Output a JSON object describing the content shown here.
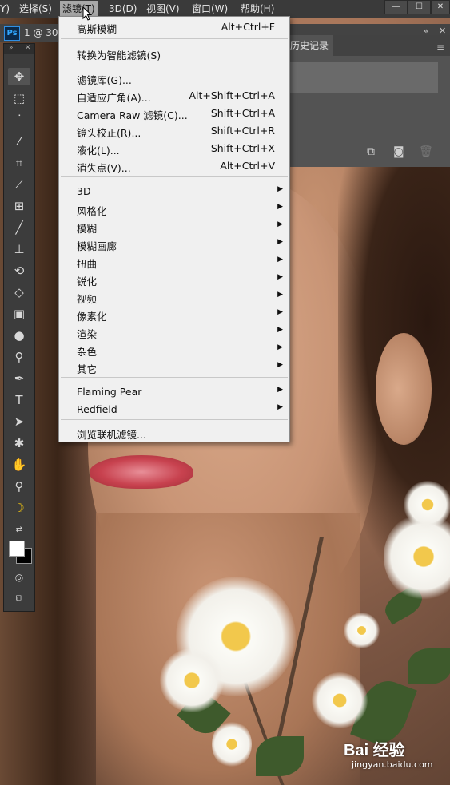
{
  "menubar": {
    "items": [
      {
        "label": "Y)",
        "active": false
      },
      {
        "label": "选择(S)",
        "active": false
      },
      {
        "label": "滤镜(T)",
        "active": true
      },
      {
        "label": "3D(D)",
        "active": false
      },
      {
        "label": "视图(V)",
        "active": false
      },
      {
        "label": "窗口(W)",
        "active": false
      },
      {
        "label": "帮助(H)",
        "active": false
      }
    ],
    "window_controls": [
      "—",
      "☐",
      "✕"
    ]
  },
  "document": {
    "app_badge": "Ps",
    "tab_title": "1 @ 30."
  },
  "panel": {
    "tab_label": "历史记录",
    "menu_icon": "≡",
    "footer_icons": [
      "new-snapshot-icon",
      "camera-icon",
      "trash-icon"
    ]
  },
  "filter_menu": {
    "items": [
      {
        "label": "高斯模糊",
        "shortcut": "Alt+Ctrl+F"
      },
      {
        "label": "转换为智能滤镜(S)",
        "shortcut": ""
      },
      {
        "label": "滤镜库(G)...",
        "shortcut": ""
      },
      {
        "label": "自适应广角(A)...",
        "shortcut": "Alt+Shift+Ctrl+A"
      },
      {
        "label": "Camera Raw 滤镜(C)...",
        "shortcut": "Shift+Ctrl+A"
      },
      {
        "label": "镜头校正(R)...",
        "shortcut": "Shift+Ctrl+R"
      },
      {
        "label": "液化(L)...",
        "shortcut": "Shift+Ctrl+X"
      },
      {
        "label": "消失点(V)...",
        "shortcut": "Alt+Ctrl+V"
      },
      {
        "label": "3D",
        "submenu": true
      },
      {
        "label": "风格化",
        "submenu": true
      },
      {
        "label": "模糊",
        "submenu": true
      },
      {
        "label": "模糊画廊",
        "submenu": true
      },
      {
        "label": "扭曲",
        "submenu": true
      },
      {
        "label": "锐化",
        "submenu": true
      },
      {
        "label": "视频",
        "submenu": true
      },
      {
        "label": "像素化",
        "submenu": true
      },
      {
        "label": "渲染",
        "submenu": true
      },
      {
        "label": "杂色",
        "submenu": true
      },
      {
        "label": "其它",
        "submenu": true
      },
      {
        "label": "Flaming Pear",
        "submenu": true
      },
      {
        "label": "Redfield",
        "submenu": true
      },
      {
        "label": "浏览联机滤镜...",
        "shortcut": ""
      }
    ]
  },
  "toolbar": {
    "tools": [
      "move-tool-icon",
      "marquee-tool-icon",
      "lasso-tool-icon",
      "magic-wand-tool-icon",
      "crop-tool-icon",
      "eyedropper-tool-icon",
      "healing-brush-tool-icon",
      "brush-tool-icon",
      "clone-stamp-tool-icon",
      "history-brush-tool-icon",
      "eraser-tool-icon",
      "gradient-tool-icon",
      "blur-tool-icon",
      "dodge-tool-icon",
      "pen-tool-icon",
      "type-tool-icon",
      "path-selection-tool-icon",
      "custom-shape-tool-icon",
      "hand-tool-icon",
      "zoom-tool-icon",
      "banana-tool-icon"
    ],
    "colors": {
      "foreground": "#ffffff",
      "background": "#000000"
    }
  },
  "watermark": {
    "main": "Bai  经验",
    "sub": "jingyan.baidu.com"
  },
  "colors": {
    "menubar": "#3a3a3a",
    "dropdown": "#f0f0f0",
    "toolbar": "#3c3c3c",
    "panel": "#535353",
    "ps_blue": "#31a8ff"
  }
}
